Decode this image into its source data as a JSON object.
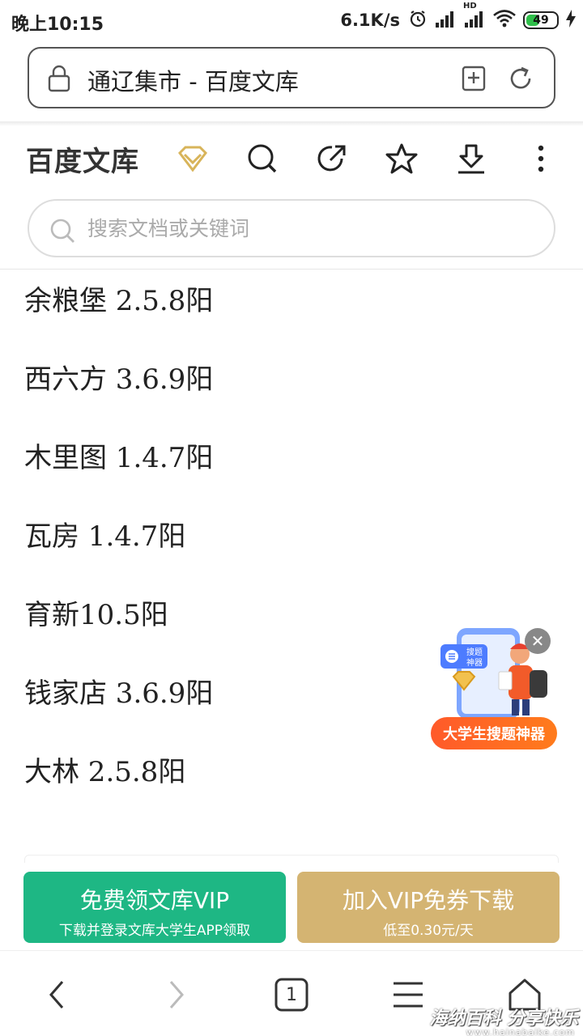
{
  "status_bar": {
    "time": "晚上10:15",
    "net_speed": "6.1K/s",
    "battery": "49",
    "battery_level_percent": 49,
    "hd_label": "HD"
  },
  "browser": {
    "url_text": "通辽集市 - 百度文库"
  },
  "wenku_header": {
    "logo": "百度文库"
  },
  "search": {
    "placeholder": "搜索文档或关键词"
  },
  "content_lines": [
    "余粮堡 2.5.8阳",
    "西六方 3.6.9阳",
    "木里图 1.4.7阳",
    "瓦房 1.4.7阳",
    "育新10.5阳",
    "钱家店 3.6.9阳",
    "大林 2.5.8阳"
  ],
  "promo": {
    "banner_label": "大学生搜题神器",
    "phone_text": "搜题神器",
    "close_symbol": "✕"
  },
  "cta": {
    "left_main": "免费领文库VIP",
    "left_sub": "下载并登录文库大学生APP领取",
    "right_main": "加入VIP免券下载",
    "right_sub": "低至0.30元/天"
  },
  "nav": {
    "tab_count": "1"
  },
  "watermark": {
    "text": "海纳百科 分享快乐",
    "url": "www.hainabaike.com"
  },
  "colors": {
    "cta_left": "#1eb784",
    "cta_right": "#d4b472",
    "promo_orange": "#ff6a22",
    "vip_gold": "#d8b45a"
  }
}
